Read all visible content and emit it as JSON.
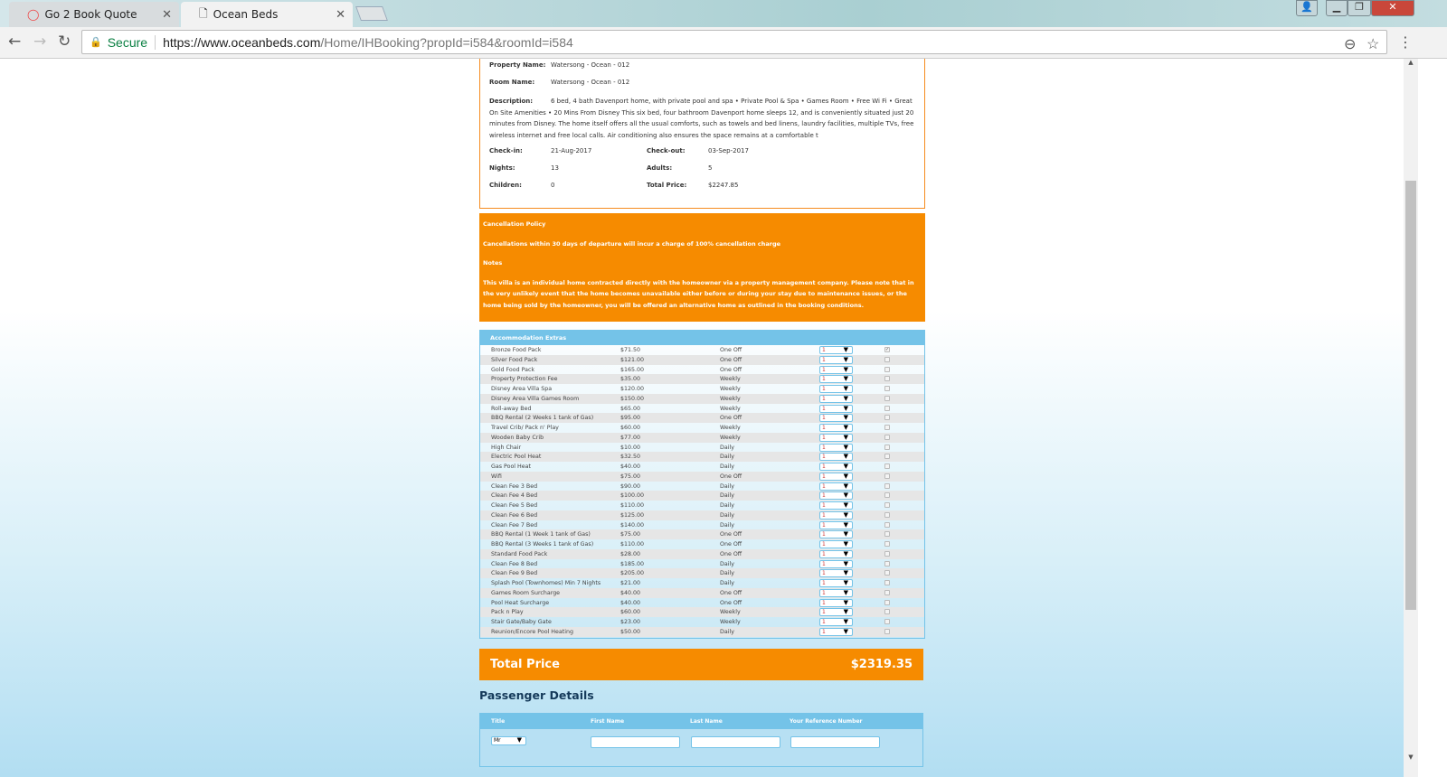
{
  "browser": {
    "tabs": [
      {
        "label": "Go 2 Book Quote"
      },
      {
        "label": "Ocean Beds"
      }
    ],
    "secure_label": "Secure",
    "url_host": "https://www.oceanbeds.com",
    "url_path": "/Home/IHBooking?propId=i584&roomId=i584"
  },
  "details": {
    "property_name_label": "Property Name:",
    "property_name": "Watersong - Ocean - 012",
    "room_name_label": "Room Name:",
    "room_name": "Watersong - Ocean - 012",
    "description_label": "Description:",
    "description": "6 bed, 4 bath Davenport home, with private pool and spa • Private Pool & Spa • Games Room • Free Wi Fi • Great On Site Amenities • 20 Mins From Disney This six bed, four bathroom Davenport home sleeps 12, and is conveniently situated just 20 minutes from Disney. The home itself offers all the usual comforts, such as towels and bed linens, laundry facilities, multiple TVs, free wireless internet and free local calls. Air conditioning also ensures the space remains at a comfortable t",
    "checkin_label": "Check-in:",
    "checkin": "21-Aug-2017",
    "checkout_label": "Check-out:",
    "checkout": "03-Sep-2017",
    "nights_label": "Nights:",
    "nights": "13",
    "adults_label": "Adults:",
    "adults": "5",
    "children_label": "Children:",
    "children": "0",
    "total_label": "Total Price:",
    "total": "$2247.85"
  },
  "policy": {
    "title": "Cancellation Policy",
    "text": "Cancellations within 30 days of departure will incur a charge of 100% cancellation charge",
    "notes_title": "Notes",
    "notes": "This villa is an individual home contracted directly with the homeowner via a property management company. Please note that in the very unlikely event that the home becomes unavailable either before or during your stay due to maintenance issues, or the home being sold by the homeowner, you will be offered an alternative home as outlined in the booking conditions."
  },
  "extras": {
    "title": "Accommodation Extras",
    "items": [
      {
        "name": "Bronze Food Pack",
        "price": "$71.50",
        "freq": "One Off",
        "qty": "1",
        "checked": true
      },
      {
        "name": "Silver Food Pack",
        "price": "$121.00",
        "freq": "One Off",
        "qty": "1",
        "checked": false
      },
      {
        "name": "Gold Food Pack",
        "price": "$165.00",
        "freq": "One Off",
        "qty": "1",
        "checked": false
      },
      {
        "name": "Property Protection Fee",
        "price": "$35.00",
        "freq": "Weekly",
        "qty": "1",
        "checked": false
      },
      {
        "name": "Disney Area Villa Spa",
        "price": "$120.00",
        "freq": "Weekly",
        "qty": "1",
        "checked": false
      },
      {
        "name": "Disney Area Villa Games Room",
        "price": "$150.00",
        "freq": "Weekly",
        "qty": "1",
        "checked": false
      },
      {
        "name": "Roll-away Bed",
        "price": "$65.00",
        "freq": "Weekly",
        "qty": "1",
        "checked": false
      },
      {
        "name": "BBQ Rental (2 Weeks 1 tank of Gas)",
        "price": "$95.00",
        "freq": "One Off",
        "qty": "1",
        "checked": false
      },
      {
        "name": "Travel Crib/ Pack n' Play",
        "price": "$60.00",
        "freq": "Weekly",
        "qty": "1",
        "checked": false
      },
      {
        "name": "Wooden Baby Crib",
        "price": "$77.00",
        "freq": "Weekly",
        "qty": "1",
        "checked": false
      },
      {
        "name": "High Chair",
        "price": "$10.00",
        "freq": "Daily",
        "qty": "1",
        "checked": false
      },
      {
        "name": "Electric Pool Heat",
        "price": "$32.50",
        "freq": "Daily",
        "qty": "1",
        "checked": false
      },
      {
        "name": "Gas Pool Heat",
        "price": "$40.00",
        "freq": "Daily",
        "qty": "1",
        "checked": false
      },
      {
        "name": "Wifi",
        "price": "$75.00",
        "freq": "One Off",
        "qty": "1",
        "checked": false
      },
      {
        "name": "Clean Fee 3 Bed",
        "price": "$90.00",
        "freq": "Daily",
        "qty": "1",
        "checked": false
      },
      {
        "name": "Clean Fee 4 Bed",
        "price": "$100.00",
        "freq": "Daily",
        "qty": "1",
        "checked": false
      },
      {
        "name": "Clean Fee 5 Bed",
        "price": "$110.00",
        "freq": "Daily",
        "qty": "1",
        "checked": false
      },
      {
        "name": "Clean Fee 6 Bed",
        "price": "$125.00",
        "freq": "Daily",
        "qty": "1",
        "checked": false
      },
      {
        "name": "Clean Fee 7 Bed",
        "price": "$140.00",
        "freq": "Daily",
        "qty": "1",
        "checked": false
      },
      {
        "name": "BBQ Rental (1 Week 1 tank of Gas)",
        "price": "$75.00",
        "freq": "One Off",
        "qty": "1",
        "checked": false
      },
      {
        "name": "BBQ Rental (3 Weeks 1 tank of Gas)",
        "price": "$110.00",
        "freq": "One Off",
        "qty": "1",
        "checked": false
      },
      {
        "name": "Standard Food Pack",
        "price": "$28.00",
        "freq": "One Off",
        "qty": "1",
        "checked": false
      },
      {
        "name": "Clean Fee 8 Bed",
        "price": "$185.00",
        "freq": "Daily",
        "qty": "1",
        "checked": false
      },
      {
        "name": "Clean Fee 9 Bed",
        "price": "$205.00",
        "freq": "Daily",
        "qty": "1",
        "checked": false
      },
      {
        "name": "Splash Pool (Townhomes) Min 7 Nights",
        "price": "$21.00",
        "freq": "Daily",
        "qty": "1",
        "checked": false
      },
      {
        "name": "Games Room Surcharge",
        "price": "$40.00",
        "freq": "One Off",
        "qty": "1",
        "checked": false
      },
      {
        "name": "Pool Heat Surcharge",
        "price": "$40.00",
        "freq": "One Off",
        "qty": "1",
        "checked": false
      },
      {
        "name": "Pack n Play",
        "price": "$60.00",
        "freq": "Weekly",
        "qty": "1",
        "checked": false
      },
      {
        "name": "Stair Gate/Baby Gate",
        "price": "$23.00",
        "freq": "Weekly",
        "qty": "1",
        "checked": false
      },
      {
        "name": "Reunion/Encore Pool Heating",
        "price": "$50.00",
        "freq": "Daily",
        "qty": "1",
        "checked": false
      }
    ]
  },
  "total": {
    "label": "Total Price",
    "value": "$2319.35"
  },
  "passenger": {
    "title": "Passenger Details",
    "col_title": "Title",
    "col_first": "First Name",
    "col_last": "Last Name",
    "col_ref": "Your Reference Number",
    "title_value": "Mr"
  },
  "colors": {
    "accent_orange": "#f68b00",
    "accent_blue": "#74c3e8"
  }
}
